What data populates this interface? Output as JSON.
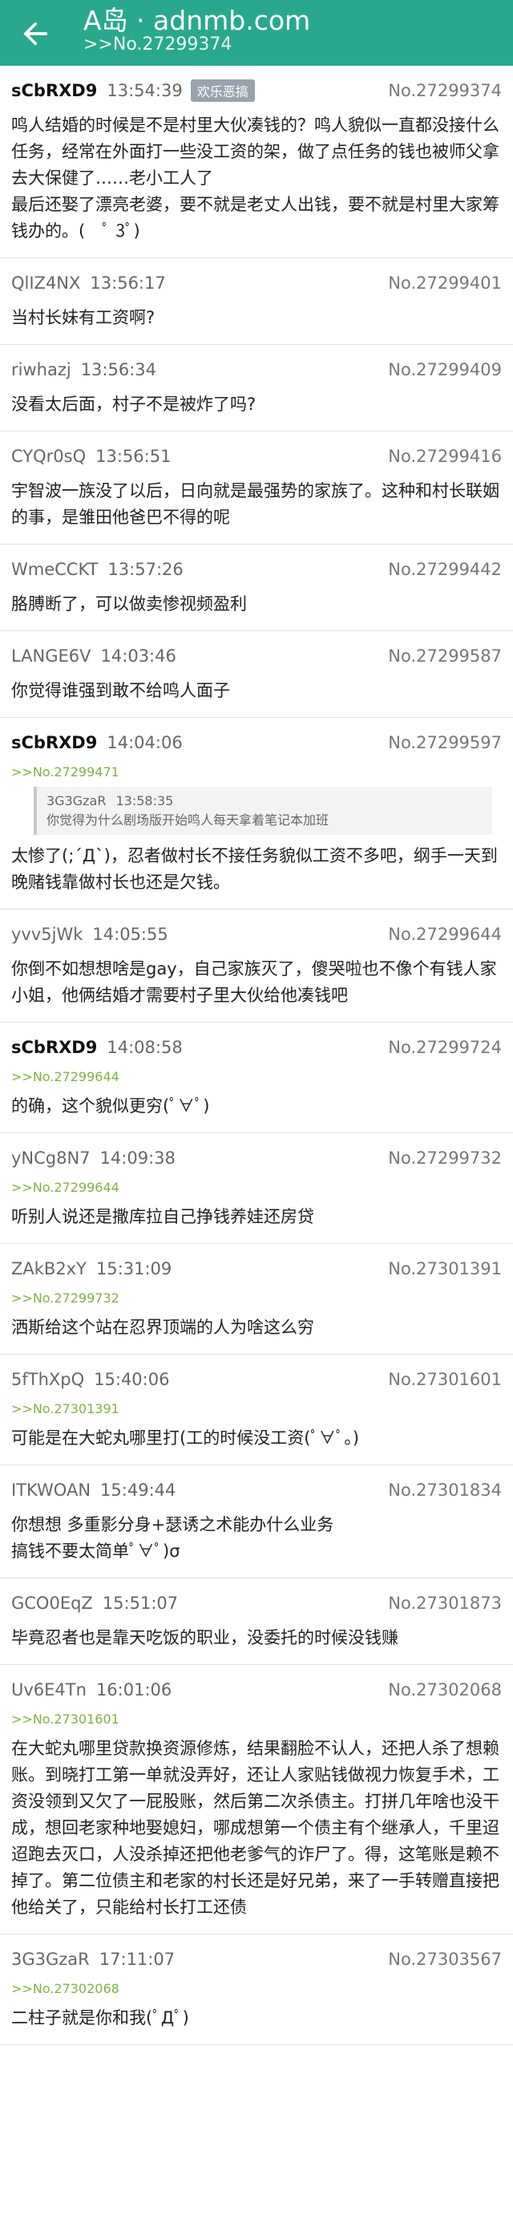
{
  "header": {
    "title": "A岛 · adnmb.com",
    "subtitle": ">>No.27299374"
  },
  "posts": [
    {
      "uid": "sCbRXD9",
      "time": "13:54:39",
      "badge": "欢乐恶搞",
      "no": "No.27299374",
      "content": "鸣人结婚的时候是不是村里大伙凑钱的？鸣人貌似一直都没接什么任务，经常在外面打一些没工资的架，做了点任务的钱也被师父拿去大保健了……老小工人了\n最后还娶了漂亮老婆，要不就是老丈人出钱，要不就是村里大家筹钱办的。(　ﾟ 3ﾟ)"
    },
    {
      "uid": "QlIZ4NX",
      "time": "13:56:17",
      "no": "No.27299401",
      "content": "当村长妹有工资啊?"
    },
    {
      "uid": "riwhazj",
      "time": "13:56:34",
      "no": "No.27299409",
      "content": "没看太后面，村子不是被炸了吗?"
    },
    {
      "uid": "CYQr0sQ",
      "time": "13:56:51",
      "no": "No.27299416",
      "content": "宇智波一族没了以后，日向就是最强势的家族了。这种和村长联姻的事，是雏田他爸巴不得的呢"
    },
    {
      "uid": "WmeCCKT",
      "time": "13:57:26",
      "no": "No.27299442",
      "content": "胳膊断了，可以做卖惨视频盈利"
    },
    {
      "uid": "LANGE6V",
      "time": "14:03:46",
      "no": "No.27299587",
      "content": "你觉得谁强到敢不给鸣人面子"
    },
    {
      "uid": "sCbRXD9",
      "time": "14:04:06",
      "no": "No.27299597",
      "ref": ">>No.27299471",
      "quote": {
        "uid": "3G3GzaR",
        "time": "13:58:35",
        "text": "你觉得为什么剧场版开始鸣人每天拿着笔记本加班"
      },
      "content": "太惨了(;´Д`)，忍者做村长不接任务貌似工资不多吧，纲手一天到晚赌钱靠做村长也还是欠钱。"
    },
    {
      "uid": "yvv5jWk",
      "time": "14:05:55",
      "no": "No.27299644",
      "content": "你倒不如想想啥是gay，自己家族灭了，傻哭啦也不像个有钱人家小姐，他俩结婚才需要村子里大伙给他凑钱吧"
    },
    {
      "uid": "sCbRXD9",
      "time": "14:08:58",
      "no": "No.27299724",
      "ref": ">>No.27299644",
      "content": "的确，这个貌似更穷(ﾟ∀ﾟ)"
    },
    {
      "uid": "yNCg8N7",
      "time": "14:09:38",
      "no": "No.27299732",
      "ref": ">>No.27299644",
      "content": "听别人说还是撒库拉自己挣钱养娃还房贷"
    },
    {
      "uid": "ZAkB2xY",
      "time": "15:31:09",
      "no": "No.27301391",
      "ref": ">>No.27299732",
      "content": "洒斯给这个站在忍界顶端的人为啥这么穷"
    },
    {
      "uid": "5fThXpQ",
      "time": "15:40:06",
      "no": "No.27301601",
      "ref": ">>No.27301391",
      "content": "可能是在大蛇丸哪里打(工的时候没工资(ﾟ∀ﾟ。)"
    },
    {
      "uid": "ITKWOAN",
      "time": "15:49:44",
      "no": "No.27301834",
      "content": "你想想 多重影分身+瑟诱之术能办什么业务\n搞钱不要太简单ﾟ∀ﾟ)σ"
    },
    {
      "uid": "GCO0EqZ",
      "time": "15:51:07",
      "no": "No.27301873",
      "content": "毕竟忍者也是靠天吃饭的职业，没委托的时候没钱赚"
    },
    {
      "uid": "Uv6E4Tn",
      "time": "16:01:06",
      "no": "No.27302068",
      "ref": ">>No.27301601",
      "content": "在大蛇丸哪里贷款换资源修炼，结果翻脸不认人，还把人杀了想赖账。到晓打工第一单就没弄好，还让人家贴钱做视力恢复手术，工资没领到又欠了一屁股账，然后第二次杀债主。打拼几年啥也没干成，想回老家种地娶媳妇，哪成想第一个债主有个继承人，千里迢迢跑去灭口，人没杀掉还把他老爹气的诈尸了。得，这笔账是赖不掉了。第二位债主和老家的村长还是好兄弟，来了一手转赠直接把他给关了，只能给村长打工还债"
    },
    {
      "uid": "3G3GzaR",
      "time": "17:11:07",
      "no": "No.27303567",
      "ref": ">>No.27302068",
      "content": "二柱子就是你和我(ﾟДﾟ)"
    }
  ]
}
